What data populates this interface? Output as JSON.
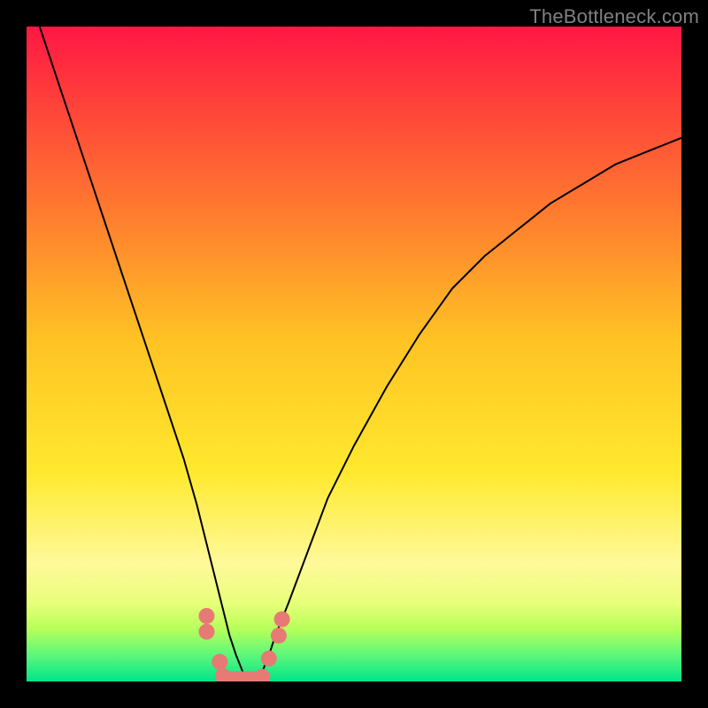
{
  "watermark": "TheBottleneck.com",
  "chart_data": {
    "type": "line",
    "title": "",
    "xlabel": "",
    "ylabel": "",
    "x_range": [
      0,
      100
    ],
    "y_range": [
      0,
      100
    ],
    "legend": false,
    "grid": false,
    "background_gradient": {
      "orientation": "vertical",
      "stops": [
        {
          "pos": 0.0,
          "color": "#ff1744"
        },
        {
          "pos": 0.1,
          "color": "#ff3b3b"
        },
        {
          "pos": 0.28,
          "color": "#ff7a2f"
        },
        {
          "pos": 0.48,
          "color": "#ffc324"
        },
        {
          "pos": 0.68,
          "color": "#ffe92e"
        },
        {
          "pos": 0.82,
          "color": "#fff99a"
        },
        {
          "pos": 0.88,
          "color": "#e8ff7a"
        },
        {
          "pos": 0.92,
          "color": "#b6ff5a"
        },
        {
          "pos": 0.96,
          "color": "#5cf77a"
        },
        {
          "pos": 1.0,
          "color": "#00e58a"
        }
      ]
    },
    "series": [
      {
        "name": "bottleneck-curve",
        "color": "#000000",
        "stroke_width": 2,
        "x": [
          2,
          4,
          6,
          8,
          10,
          12,
          14,
          16,
          18,
          20,
          22,
          24,
          26,
          27,
          28,
          29,
          30,
          31,
          32,
          33,
          34,
          35,
          36,
          37,
          38,
          40,
          43,
          46,
          50,
          55,
          60,
          65,
          70,
          75,
          80,
          85,
          90,
          95,
          100
        ],
        "y": [
          100,
          94,
          88,
          82,
          76,
          70,
          64,
          58,
          52,
          46,
          40,
          34,
          27,
          23,
          19,
          15,
          11,
          7,
          4,
          1.5,
          0.5,
          0.5,
          1.5,
          4,
          7,
          12,
          20,
          28,
          36,
          45,
          53,
          60,
          65,
          69,
          73,
          76,
          79,
          81,
          83
        ]
      },
      {
        "name": "markers-near-minimum",
        "type": "scatter",
        "color": "#e77a74",
        "marker_radius": 9,
        "points": [
          {
            "x": 27.5,
            "y": 10.0
          },
          {
            "x": 27.5,
            "y": 7.6
          },
          {
            "x": 29.5,
            "y": 3.0
          },
          {
            "x": 30.0,
            "y": 0.8
          },
          {
            "x": 36.0,
            "y": 0.7
          },
          {
            "x": 37.0,
            "y": 3.5
          },
          {
            "x": 38.5,
            "y": 7.0
          },
          {
            "x": 39.0,
            "y": 9.5
          }
        ]
      },
      {
        "name": "bottom-band",
        "type": "line",
        "color": "#e77a74",
        "stroke_width": 14,
        "x": [
          30.0,
          36.0
        ],
        "y": [
          0.6,
          0.6
        ]
      }
    ]
  }
}
